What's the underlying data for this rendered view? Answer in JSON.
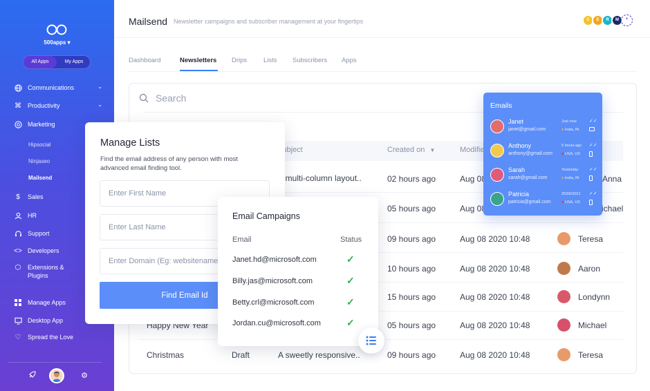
{
  "sidebar": {
    "brand": "500apps",
    "toggle": {
      "all": "All Apps",
      "mine": "My Apps"
    },
    "items": [
      {
        "label": "Communications",
        "icon": "globe-icon"
      },
      {
        "label": "Productivity",
        "icon": "command-icon"
      },
      {
        "label": "Marketing",
        "icon": "target-icon"
      },
      {
        "label": "Sales",
        "icon": "dollar-icon"
      },
      {
        "label": "HR",
        "icon": "user-icon"
      },
      {
        "label": "Support",
        "icon": "headset-icon"
      },
      {
        "label": "Developers",
        "icon": "code-icon"
      },
      {
        "label": "Extensions & Plugins",
        "icon": "puzzle-icon"
      },
      {
        "label": "Manage Apps",
        "icon": "grid-icon"
      },
      {
        "label": "Desktop App",
        "icon": "monitor-icon"
      },
      {
        "label": "Spread the Love",
        "icon": "heart-icon"
      }
    ],
    "marketing_sub": [
      "Hipsocial",
      "Ninjaseo",
      "Mailsend"
    ]
  },
  "header": {
    "title": "Mailsend",
    "subtitle": "Newsletter campaigns and subscriber management at your fingertips",
    "team_initials": [
      "C",
      "E",
      "R",
      "M"
    ]
  },
  "tabs": [
    "Dashboard",
    "Newsletters",
    "Drips",
    "Lists",
    "Subscribers",
    "Apps"
  ],
  "search": {
    "placeholder": "Search"
  },
  "table": {
    "headers": {
      "subject": "Subject",
      "created": "Created on",
      "modified": "Modified"
    },
    "rows": [
      {
        "name": "",
        "status": "",
        "subject": "A multi-column layout..",
        "created": "02 hours ago",
        "modified": "Aug 08 2020 10:48",
        "owner": "Anna"
      },
      {
        "name": "",
        "status": "",
        "subject": "",
        "created": "05 hours ago",
        "modified": "Aug 08 2020 10:48",
        "owner": "Michael"
      },
      {
        "name": "",
        "status": "",
        "subject": "",
        "created": "09 hours ago",
        "modified": "Aug 08 2020 10:48",
        "owner": "Teresa"
      },
      {
        "name": "",
        "status": "",
        "subject": "",
        "created": "10 hours ago",
        "modified": "Aug 08 2020 10:48",
        "owner": "Aaron"
      },
      {
        "name": "",
        "status": "",
        "subject": "",
        "created": "15 hours ago",
        "modified": "Aug 08 2020 10:48",
        "owner": "Londynn"
      },
      {
        "name": "Happy New Year",
        "status": "",
        "subject": "",
        "created": "05 hours ago",
        "modified": "Aug 08 2020 10:48",
        "owner": "Michael"
      },
      {
        "name": "Christmas",
        "status": "Draft",
        "subject": "A sweetly responsive..",
        "created": "09 hours ago",
        "modified": "Aug 08 2020 10:48",
        "owner": "Teresa"
      }
    ]
  },
  "manage_lists": {
    "title": "Manage Lists",
    "description": "Find the email address of any person with most advanced email finding tool.",
    "first_name_placeholder": "Enter First Name",
    "last_name_placeholder": "Enter Last Name",
    "domain_placeholder": "Enter Domain (Eg: websitename.com)",
    "button": "Find Email Id"
  },
  "campaigns": {
    "title": "Email Campaigns",
    "col_email": "Email",
    "col_status": "Status",
    "emails": [
      "Janet.hd@microsoft.com",
      "Billy.jas@microsoft.com",
      "Betty.crl@microsoft.com",
      "Jordan.cu@microsoft.com"
    ]
  },
  "emails_panel": {
    "title": "Emails",
    "rows": [
      {
        "name": "Janet",
        "email": "janet@gmail.com",
        "time": "Just now",
        "location": "India, IN"
      },
      {
        "name": "Anthony",
        "email": "anthony@gmail.com",
        "time": "5 hours ago",
        "location": "USA, US"
      },
      {
        "name": "Sarah",
        "email": "sarah@gmail.com",
        "time": "Yesterday",
        "location": "India, IN"
      },
      {
        "name": "Patricia",
        "email": "patricia@gmail.com",
        "time": "25/06/2021",
        "location": "USA, US"
      }
    ]
  },
  "colors": {
    "accent": "#5b8ef8",
    "success": "#2fb14a",
    "sidebar_top": "#2b6cf0",
    "sidebar_bottom": "#6a3fd2"
  }
}
